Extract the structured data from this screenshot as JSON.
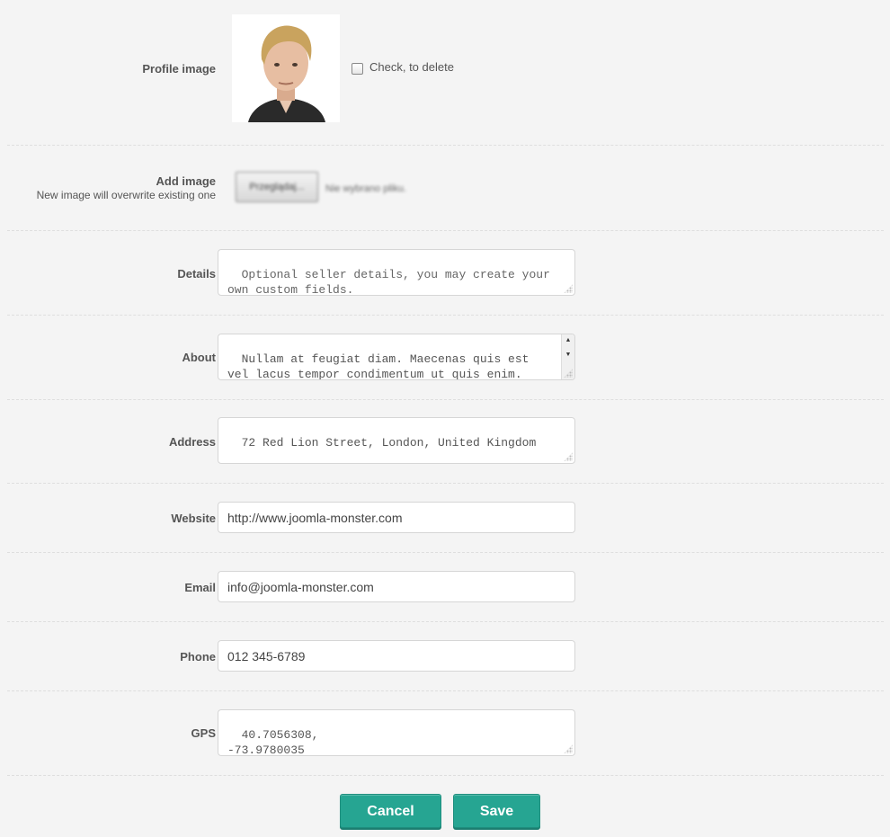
{
  "profile_image": {
    "label": "Profile image",
    "delete_label": "Check, to delete",
    "delete_checked": false
  },
  "add_image": {
    "label": "Add image",
    "sublabel": "New image will overwrite existing one",
    "button_label": "Przeglądaj...",
    "status": "Nie wybrano pliku."
  },
  "details": {
    "label": "Details",
    "placeholder": "Optional seller details, you may create your own custom fields."
  },
  "about": {
    "label": "About",
    "value": "Nullam at feugiat diam. Maecenas quis est vel lacus tempor condimentum ut quis enim. Donec et placerat lorem. Integer convallis"
  },
  "address": {
    "label": "Address",
    "value": "72 Red Lion Street, London, United Kingdom"
  },
  "website": {
    "label": "Website",
    "value": "http://www.joomla-monster.com"
  },
  "email": {
    "label": "Email",
    "value": "info@joomla-monster.com"
  },
  "phone": {
    "label": "Phone",
    "value": "012 345-6789"
  },
  "gps": {
    "label": "GPS",
    "value": "40.7056308,\n-73.9780035"
  },
  "actions": {
    "cancel_label": "Cancel",
    "save_label": "Save"
  },
  "colors": {
    "accent": "#26a592",
    "background": "#f4f4f4"
  }
}
